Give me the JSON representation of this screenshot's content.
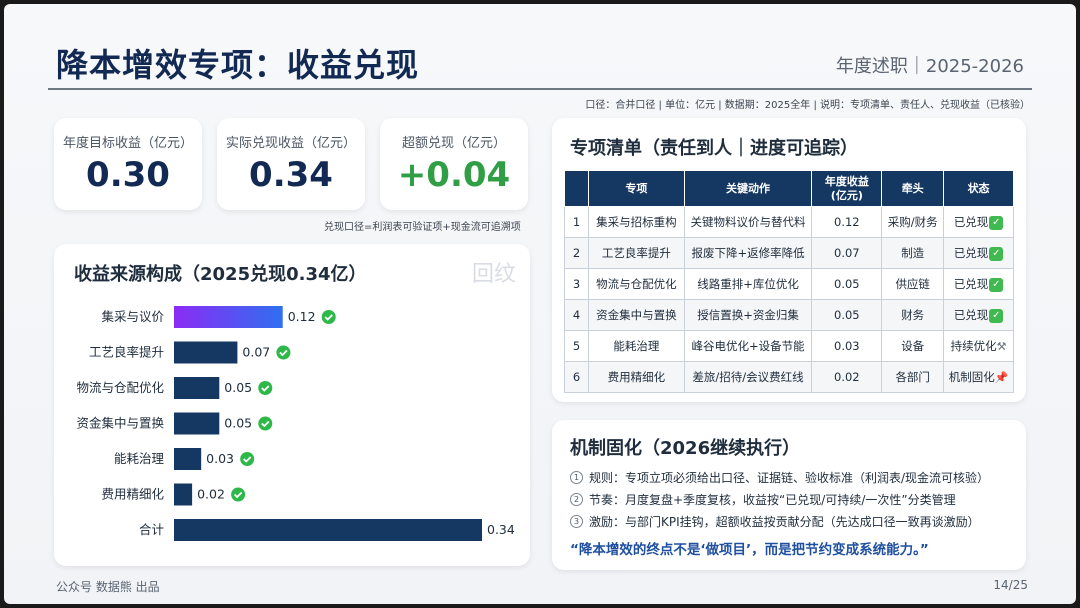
{
  "header": {
    "title": "降本增效专项：收益兑现",
    "right_label": "年度述职｜2025-2026",
    "note": "口径：合并口径 | 单位：亿元 | 数据期：2025全年 | 说明：专项清单、责任人、兑现收益（已核验）"
  },
  "kpis": [
    {
      "label": "年度目标收益（亿元）",
      "value": "0.30",
      "color": "#122a53"
    },
    {
      "label": "实际兑现收益（亿元）",
      "value": "0.34",
      "color": "#122a53"
    },
    {
      "label": "超额兑现（亿元）",
      "value": "+0.04",
      "color": "#2f9e44"
    }
  ],
  "kpi_note": "兑现口径=利润表可验证项+现金流可追溯项",
  "chart_card": {
    "title": "收益来源构成（2025兑现0.34亿）",
    "watermark": "回纹"
  },
  "chart_data": {
    "type": "bar",
    "orientation": "horizontal",
    "categories": [
      "集采与议价",
      "工艺良率提升",
      "物流与仓配优化",
      "资金集中与置换",
      "能耗治理",
      "费用精细化",
      "合计"
    ],
    "values": [
      0.12,
      0.07,
      0.05,
      0.05,
      0.03,
      0.02,
      0.34
    ],
    "value_labels": [
      "0.12",
      "0.07",
      "0.05",
      "0.05",
      "0.03",
      "0.02",
      "0.34"
    ],
    "checked": [
      true,
      true,
      true,
      true,
      true,
      true,
      false
    ],
    "highlight_first": true,
    "colors": {
      "bar": "#153863",
      "highlight_start": "#8b2cf5",
      "highlight_end": "#2f6ff0",
      "check": "#2fb84a"
    },
    "xlim": [
      0,
      0.34
    ]
  },
  "plan_card": {
    "title": "专项清单（责任到人｜进度可追踪）",
    "headers": [
      "",
      "专项",
      "关键动作",
      "年度收益\n(亿元)",
      "牵头",
      "状态"
    ],
    "rows": [
      {
        "no": "1",
        "item": "集采与招标重构",
        "action": "关键物料议价与替代料",
        "gain": "0.12",
        "lead": "采购/财务",
        "status": "已兑现",
        "icon": "check-icon"
      },
      {
        "no": "2",
        "item": "工艺良率提升",
        "action": "报废下降+返修率降低",
        "gain": "0.07",
        "lead": "制造",
        "status": "已兑现",
        "icon": "check-icon"
      },
      {
        "no": "3",
        "item": "物流与仓配优化",
        "action": "线路重排+库位优化",
        "gain": "0.05",
        "lead": "供应链",
        "status": "已兑现",
        "icon": "check-icon"
      },
      {
        "no": "4",
        "item": "资金集中与置换",
        "action": "授信置换+资金归集",
        "gain": "0.05",
        "lead": "财务",
        "status": "已兑现",
        "icon": "check-icon"
      },
      {
        "no": "5",
        "item": "能耗治理",
        "action": "峰谷电优化+设备节能",
        "gain": "0.03",
        "lead": "设备",
        "status": "持续优化",
        "icon": "wrench-icon"
      },
      {
        "no": "6",
        "item": "费用精细化",
        "action": "差旅/招待/会议费红线",
        "gain": "0.02",
        "lead": "各部门",
        "status": "机制固化",
        "icon": "pin-icon"
      }
    ]
  },
  "mech_card": {
    "title": "机制固化（2026继续执行）",
    "items": [
      {
        "num": "1",
        "text": "规则：专项立项必须给出口径、证据链、验收标准（利润表/现金流可核验）"
      },
      {
        "num": "2",
        "text": "节奏：月度复盘+季度复核，收益按“已兑现/可持续/一次性”分类管理"
      },
      {
        "num": "3",
        "text": "激励：与部门KPI挂钩，超额收益按贡献分配（先达成口径一致再谈激励）"
      }
    ],
    "quote": "“降本增效的终点不是‘做项目’，而是把节约变成系统能力。”"
  },
  "footer": {
    "left": "公众号 数据熊 出品",
    "right": "14/25"
  }
}
